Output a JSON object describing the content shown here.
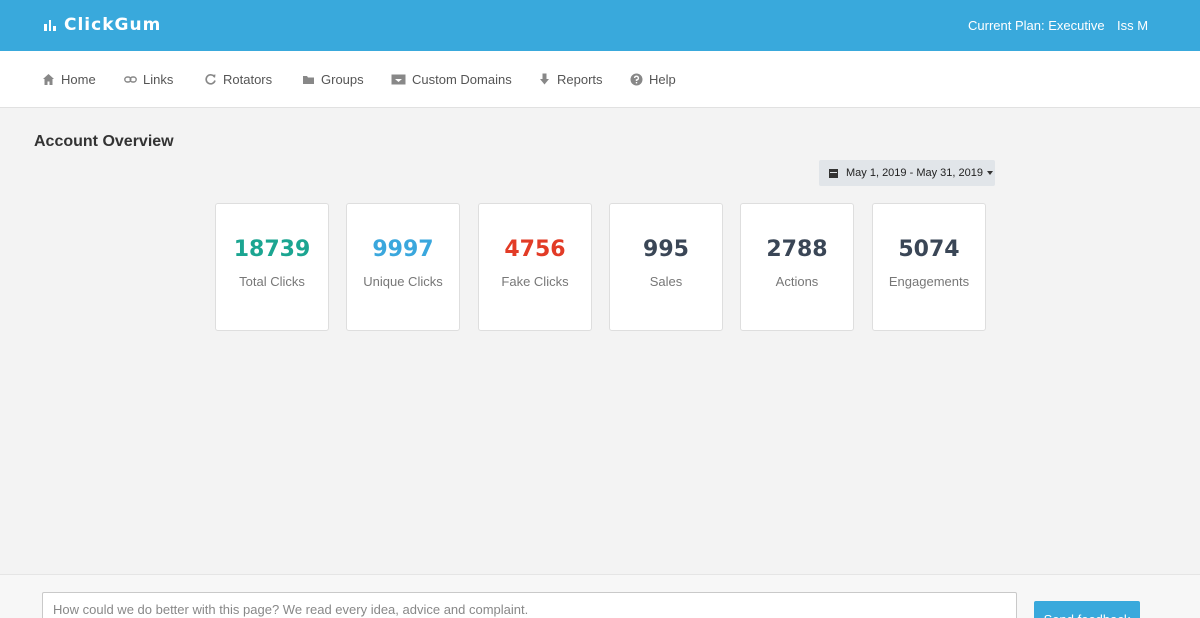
{
  "app": {
    "brand": "ClickGum",
    "current_plan": "Current Plan: Executive",
    "user_name": "Iss M"
  },
  "nav": {
    "items": [
      {
        "label": "Home",
        "icon": "home-icon"
      },
      {
        "label": "Links",
        "icon": "link-icon"
      },
      {
        "label": "Rotators",
        "icon": "refresh-icon"
      },
      {
        "label": "Groups",
        "icon": "folder-icon"
      },
      {
        "label": "Custom Domains",
        "icon": "domain-icon"
      },
      {
        "label": "Reports",
        "icon": "download-icon"
      },
      {
        "label": "Help",
        "icon": "question-icon"
      }
    ]
  },
  "page": {
    "title": "Account Overview",
    "date_range": "May 1, 2019 - May 31, 2019"
  },
  "stats": [
    {
      "value": "18739",
      "label": "Total Clicks",
      "color": "#1ba591"
    },
    {
      "value": "9997",
      "label": "Unique Clicks",
      "color": "#3aa7dd"
    },
    {
      "value": "4756",
      "label": "Fake Clicks",
      "color": "#e23b26"
    },
    {
      "value": "995",
      "label": "Sales",
      "color": "#3a4656"
    },
    {
      "value": "2788",
      "label": "Actions",
      "color": "#3a4656"
    },
    {
      "value": "5074",
      "label": "Engagements",
      "color": "#3a4656"
    }
  ],
  "feedback": {
    "placeholder": "How could we do better with this page? We read every idea, advice and complaint.",
    "button_label": "Send feedback"
  },
  "colors": {
    "header": "#39a9dc",
    "background": "#f3f3f3"
  }
}
